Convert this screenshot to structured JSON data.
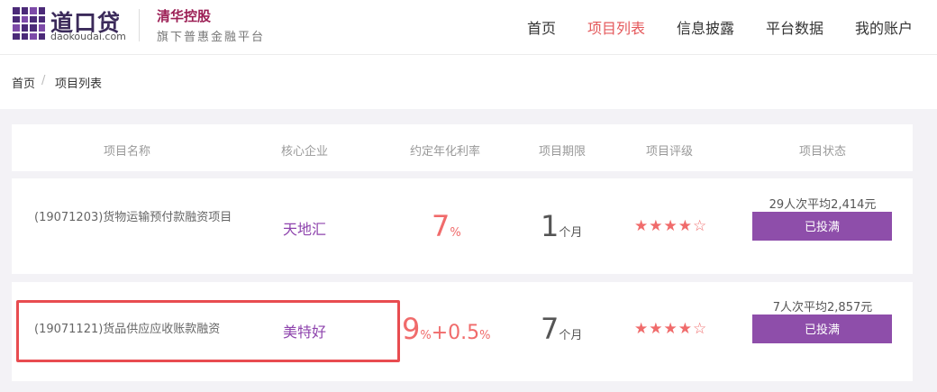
{
  "header": {
    "logo_text": "道口贷",
    "logo_domain": "daokoudai.com",
    "slogan_brand": "清华控股",
    "slogan_sub": "旗下普惠金融平台",
    "nav": [
      {
        "label": "首页",
        "active": false
      },
      {
        "label": "项目列表",
        "active": true
      },
      {
        "label": "信息披露",
        "active": false
      },
      {
        "label": "平台数据",
        "active": false
      },
      {
        "label": "我的账户",
        "active": false
      }
    ]
  },
  "breadcrumb": {
    "home": "首页",
    "separator": "/",
    "current": "项目列表"
  },
  "table": {
    "headers": [
      "项目名称",
      "核心企业",
      "约定年化利率",
      "项目期限",
      "项目评级",
      "项目状态"
    ],
    "rows": [
      {
        "name": "(19071203)货物运输预付款融资项目",
        "company": "天地汇",
        "rate": "7",
        "rate_unit": "%",
        "rate_extra": "",
        "period": "1",
        "period_unit": "个月",
        "rating_filled": 4,
        "rating_total": 5,
        "stars": "★★★★☆",
        "stats": "29人次平均2,414元",
        "status": "已投满"
      },
      {
        "name": "(19071121)货品供应应收账款融资",
        "company": "美特好",
        "rate": "9",
        "rate_unit": "%",
        "rate_extra": "+0.5",
        "rate_extra_unit": "%",
        "period": "7",
        "period_unit": "个月",
        "rating_filled": 4,
        "rating_total": 5,
        "stars": "★★★★☆",
        "stats": "7人次平均2,857元",
        "status": "已投满"
      }
    ]
  },
  "colors": {
    "accent": "#e4585b",
    "brand_purple": "#8e4eaa",
    "highlight_border": "#e84c50"
  }
}
